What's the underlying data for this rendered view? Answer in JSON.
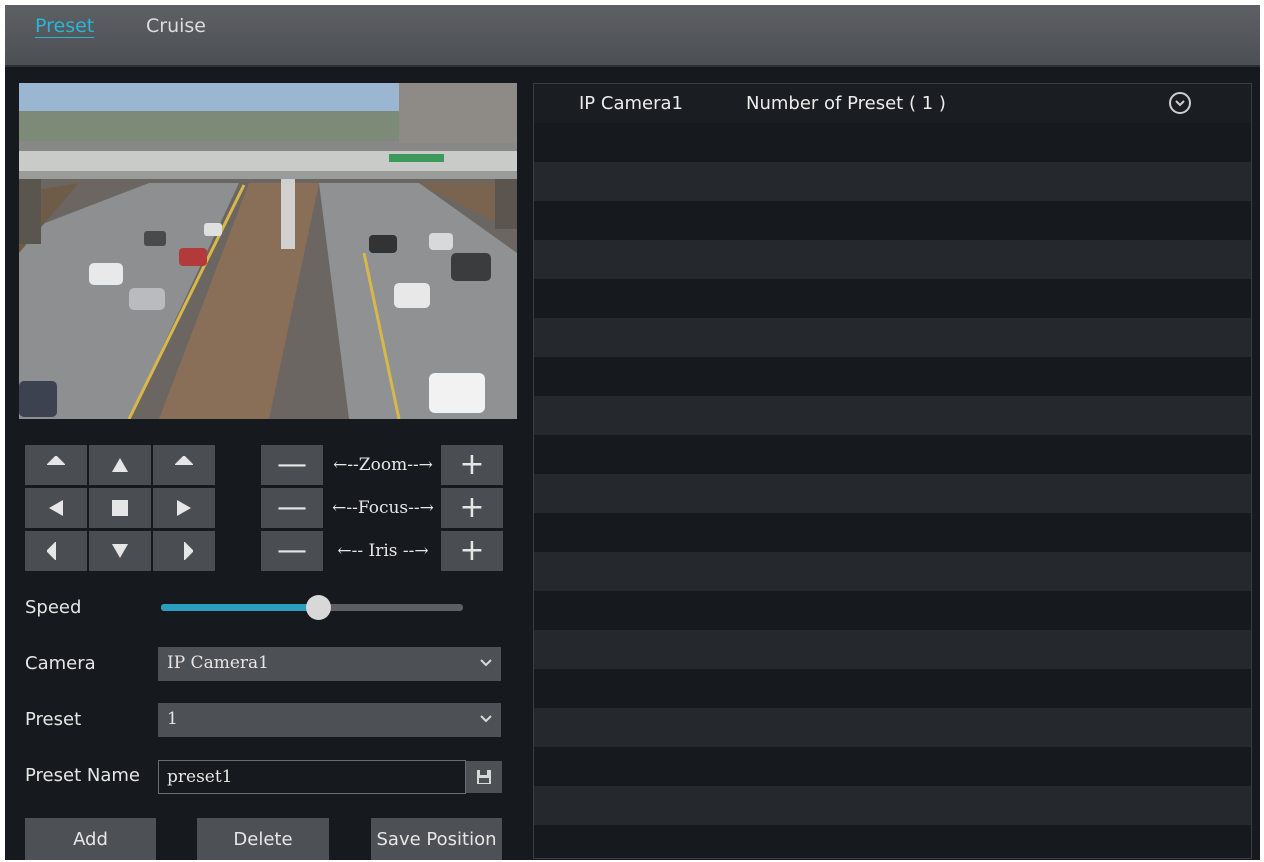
{
  "tabs": [
    {
      "label": "Preset",
      "active": true
    },
    {
      "label": "Cruise",
      "active": false
    }
  ],
  "video": {
    "description_icon": "camera-live-view"
  },
  "ptz": {
    "zoom_label": "←--Zoom--→",
    "focus_label": "←--Focus--→",
    "iris_label": "←-- Iris --→",
    "minus": "—",
    "plus": "+"
  },
  "form": {
    "speed_label": "Speed",
    "speed_value_fraction": 0.52,
    "camera_label": "Camera",
    "camera_value": "IP Camera1",
    "preset_label": "Preset",
    "preset_value": "1",
    "preset_name_label": "Preset Name",
    "preset_name_value": "preset1"
  },
  "actions": {
    "add": "Add",
    "delete": "Delete",
    "save_position": "Save Position"
  },
  "list": {
    "camera": "IP Camera1",
    "preset_count": "Number of Preset ( 1 )"
  },
  "colors": {
    "accent": "#29b6d6",
    "slider": "#2aa0be",
    "button": "#4a4d51",
    "background": "#16191d"
  }
}
